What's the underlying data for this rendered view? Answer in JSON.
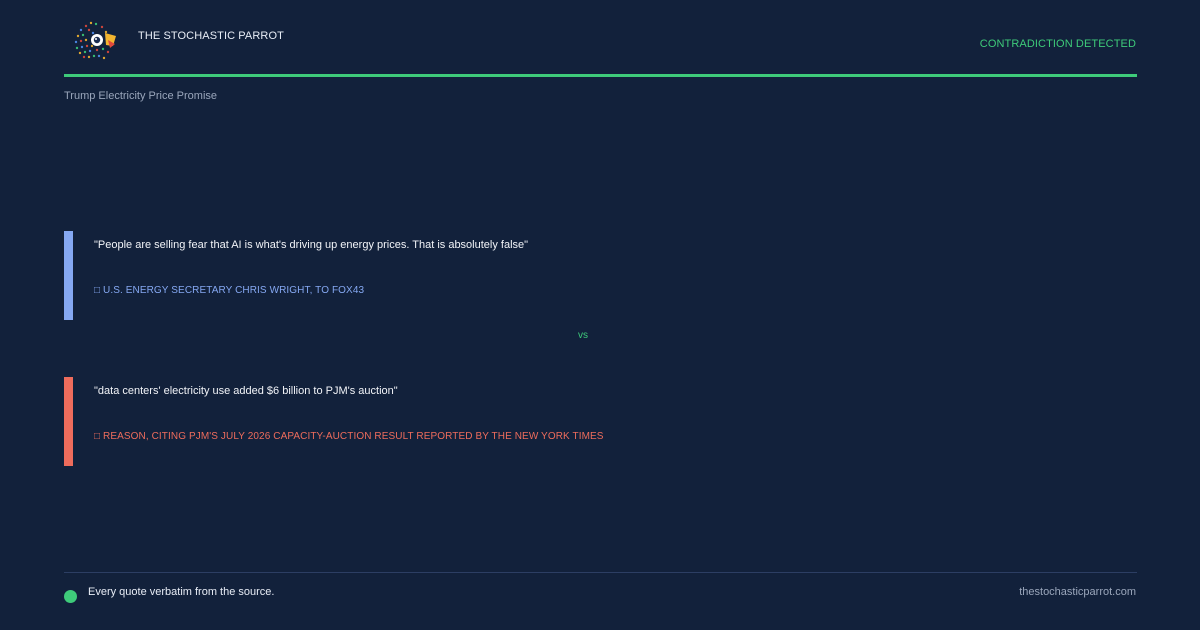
{
  "header": {
    "brand": "THE STOCHASTIC PARROT",
    "status": "CONTRADICTION DETECTED",
    "logo_icon": "parrot-logo-icon"
  },
  "topic": "Trump Electricity Price Promise",
  "quotes": [
    {
      "text": "\"People are selling fear that AI is what's driving up energy prices. That is absolutely false\"",
      "attribution": "□ U.S. ENERGY SECRETARY CHRIS WRIGHT, TO FOX43",
      "color": "#85a8f2"
    },
    {
      "text": "\"data centers' electricity use added $6 billion to PJM's auction\"",
      "attribution": "□ REASON, CITING PJM'S JULY 2026 CAPACITY-AUCTION RESULT REPORTED BY THE NEW YORK TIMES",
      "color": "#ee6c5c"
    }
  ],
  "separator": "vs",
  "footer": {
    "note": "Every quote verbatim from the source.",
    "site": "thestochasticparrot.com"
  },
  "colors": {
    "background": "#12213b",
    "accent": "#3ecb7a"
  }
}
